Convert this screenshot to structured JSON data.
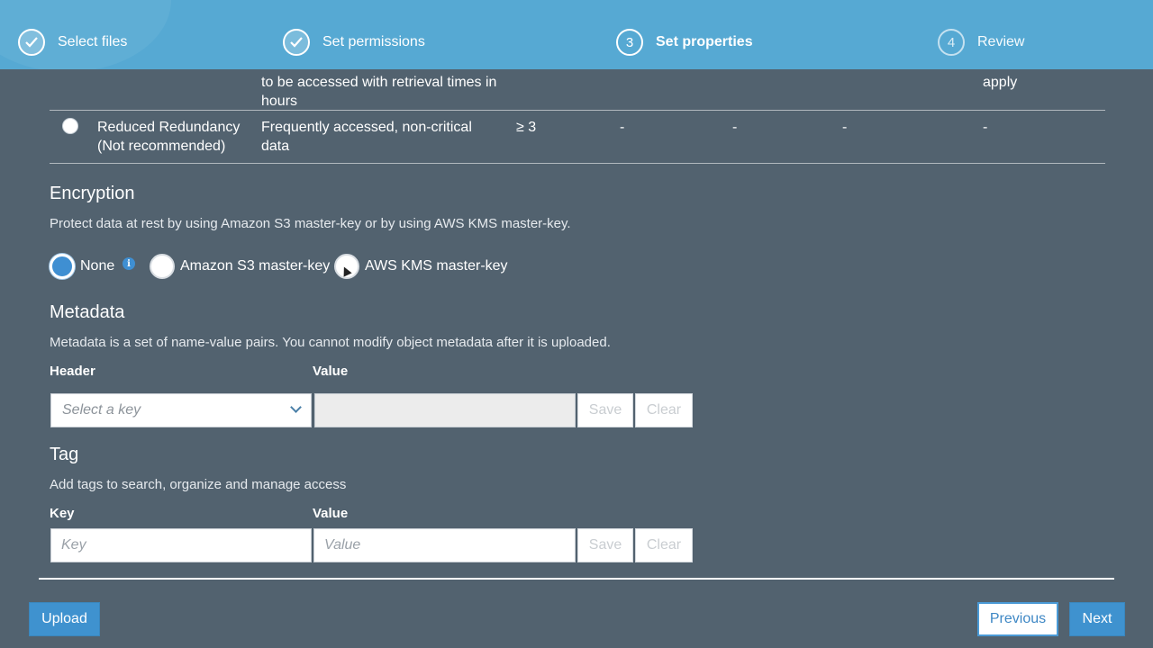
{
  "steps": [
    {
      "number": "1",
      "label": "Select files",
      "state": "done"
    },
    {
      "number": "2",
      "label": "Set permissions",
      "state": "done"
    },
    {
      "number": "3",
      "label": "Set properties",
      "state": "active"
    },
    {
      "number": "4",
      "label": "Review",
      "state": "pending"
    }
  ],
  "storage_classes": {
    "partial_row": {
      "description_tail_1": "to be accessed with retrieval times in",
      "description_tail_2": "hours",
      "last_col": "apply"
    },
    "reduced_row": {
      "name_1": "Reduced Redundancy",
      "name_2": "(Not recommended)",
      "description_1": "Frequently accessed, non-critical",
      "description_2": "data",
      "availability_zones": "≥ 3",
      "col_a": "-",
      "col_b": "-",
      "col_c": "-",
      "col_d": "-"
    }
  },
  "encryption": {
    "title": "Encryption",
    "description": "Protect data at rest by using Amazon S3 master-key or by using AWS KMS master-key.",
    "options": [
      {
        "label": "None",
        "selected": true
      },
      {
        "label": "Amazon S3 master-key",
        "selected": false
      },
      {
        "label": "AWS KMS master-key",
        "selected": false
      }
    ],
    "info_icon": "info-icon"
  },
  "metadata": {
    "title": "Metadata",
    "description": "Metadata is a set of name-value pairs. You cannot modify object metadata after it is uploaded.",
    "header_label": "Header",
    "value_label": "Value",
    "select_placeholder": "Select a key",
    "save_label": "Save",
    "clear_label": "Clear"
  },
  "tag": {
    "title": "Tag",
    "description": "Add tags to search, organize and manage access",
    "key_label": "Key",
    "value_label": "Value",
    "key_placeholder": "Key",
    "value_placeholder": "Value",
    "save_label": "Save",
    "clear_label": "Clear"
  },
  "footer": {
    "upload_label": "Upload",
    "previous_label": "Previous",
    "next_label": "Next"
  },
  "colors": {
    "page_bg": "#52626f",
    "header_bg": "#56a9d3",
    "primary": "#3f92cf"
  }
}
